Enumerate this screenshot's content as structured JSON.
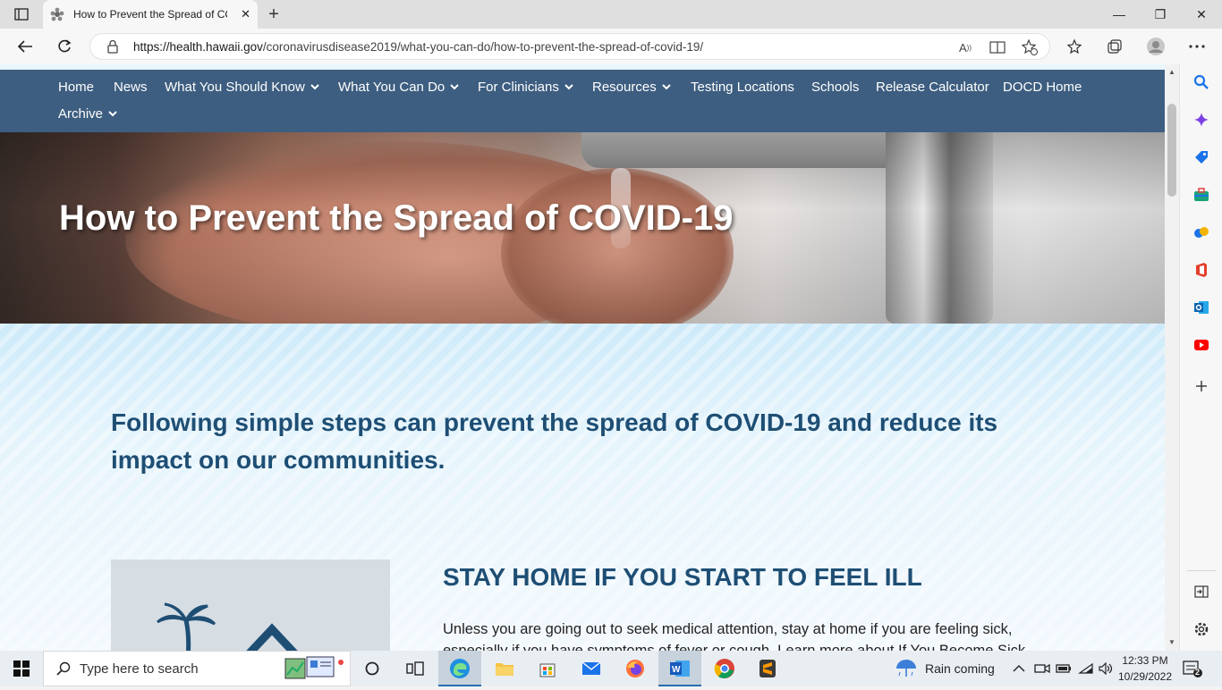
{
  "browser": {
    "tab_title": "How to Prevent the Spread of CC",
    "tab_close": "✕",
    "new_tab": "+",
    "url_host": "https://health.hawaii.gov",
    "url_path": "/coronavirusdisease2019/what-you-can-do/how-to-prevent-the-spread-of-covid-19/",
    "window_minimize": "—",
    "window_restore": "❐",
    "window_close": "✕"
  },
  "nav": {
    "items": [
      {
        "label": "Home"
      },
      {
        "label": "News"
      },
      {
        "label": "What You Should Know",
        "dropdown": true
      },
      {
        "label": "What You Can Do",
        "dropdown": true
      },
      {
        "label": "For Clinicians",
        "dropdown": true
      },
      {
        "label": "Resources",
        "dropdown": true
      },
      {
        "label": "Testing Locations"
      },
      {
        "label": "Schools"
      },
      {
        "label": "Release Calculator"
      },
      {
        "label": "DOCD Home"
      },
      {
        "label": "Archive",
        "dropdown": true
      }
    ]
  },
  "hero": {
    "title": "How to Prevent the Spread of COVID-19"
  },
  "main": {
    "lead": "Following simple steps can prevent the spread of COVID-19 and reduce its impact on our communities.",
    "section_title": "STAY HOME IF YOU START TO FEEL ILL",
    "section_body": "Unless you are going out to seek medical attention, stay at home if you are feeling sick, especially if you have symptoms of fever or cough. Learn more about If You Become Sick."
  },
  "taskbar": {
    "search_placeholder": "Type here to search",
    "weather": "Rain coming",
    "time": "12:33 PM",
    "date": "10/29/2022",
    "notifications": "2"
  },
  "colors": {
    "nav_bg": "#3d5e80",
    "heading": "#1e4e74",
    "page_bg": "#eaf6fd"
  }
}
